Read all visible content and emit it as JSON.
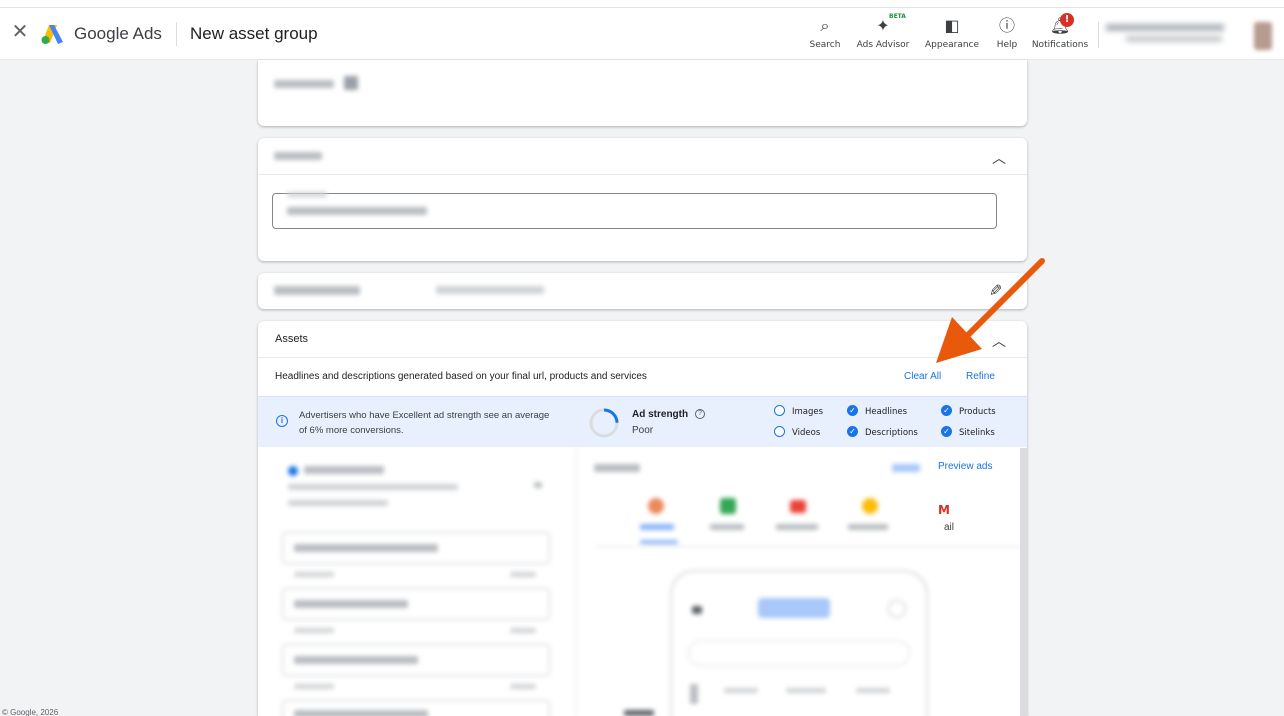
{
  "header": {
    "close_icon": "close-icon",
    "brand": "Google Ads",
    "page_title": "New asset group",
    "tools": [
      {
        "label": "Search",
        "icon": "search-icon"
      },
      {
        "label": "Ads Advisor",
        "icon": "sparkle-icon",
        "badge": "BETA"
      },
      {
        "label": "Appearance",
        "icon": "appearance-icon"
      },
      {
        "label": "Help",
        "icon": "help-icon"
      },
      {
        "label": "Notifications",
        "icon": "bell-icon",
        "badge": "!"
      }
    ]
  },
  "assets": {
    "title": "Assets",
    "subtitle": "Headlines and descriptions generated based on your final url, products and services",
    "clear_all": "Clear All",
    "refine": "Refine",
    "info_text": "Advertisers who have Excellent ad strength see an average of 6% more conversions.",
    "ad_strength_label": "Ad strength",
    "ad_strength_value": "Poor",
    "checklist": [
      {
        "label": "Images",
        "done": false
      },
      {
        "label": "Headlines",
        "done": true
      },
      {
        "label": "Products",
        "done": true
      },
      {
        "label": "Videos",
        "done": false
      },
      {
        "label": "Descriptions",
        "done": true
      },
      {
        "label": "Sitelinks",
        "done": true
      }
    ],
    "preview_ads": "Preview ads",
    "gmail_suffix": "ail"
  },
  "footer": "© Google, 2026",
  "colors": {
    "accent": "#1a73e8",
    "annotation_arrow": "#e8590c",
    "info_bar": "#e8f0fe"
  }
}
